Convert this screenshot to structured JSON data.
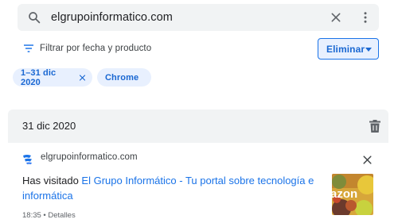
{
  "search": {
    "query": "elgrupoinformatico.com",
    "search_icon": "search-icon",
    "clear_icon": "close-icon",
    "menu_icon": "more-vert-icon"
  },
  "filter": {
    "label": "Filtrar por fecha y producto",
    "icon": "filter-list-icon"
  },
  "delete_button": {
    "label": "Eliminar",
    "icon": "caret-down-icon"
  },
  "chips": [
    {
      "label": "1–31 dic 2020",
      "remove_icon": "close-icon"
    },
    {
      "label": "Chrome",
      "remove_icon": "close-icon"
    }
  ],
  "history": {
    "date_label": "31 dic 2020",
    "delete_icon": "trash-icon",
    "entry": {
      "domain": "elgrupoinformatico.com",
      "favicon": "site-favicon",
      "prefix": "Has visitado ",
      "title": "El Grupo Informático - Tu portal sobre tecnología e informática",
      "time": "18:35",
      "separator": " • ",
      "details": "Detalles",
      "remove_icon": "close-icon",
      "thumbnail_text": "azon"
    }
  },
  "colors": {
    "accent": "#1a73e8",
    "chip_bg": "#e8f0fe",
    "surface": "#f1f3f4",
    "text": "#202124",
    "secondary_text": "#5f6368"
  }
}
